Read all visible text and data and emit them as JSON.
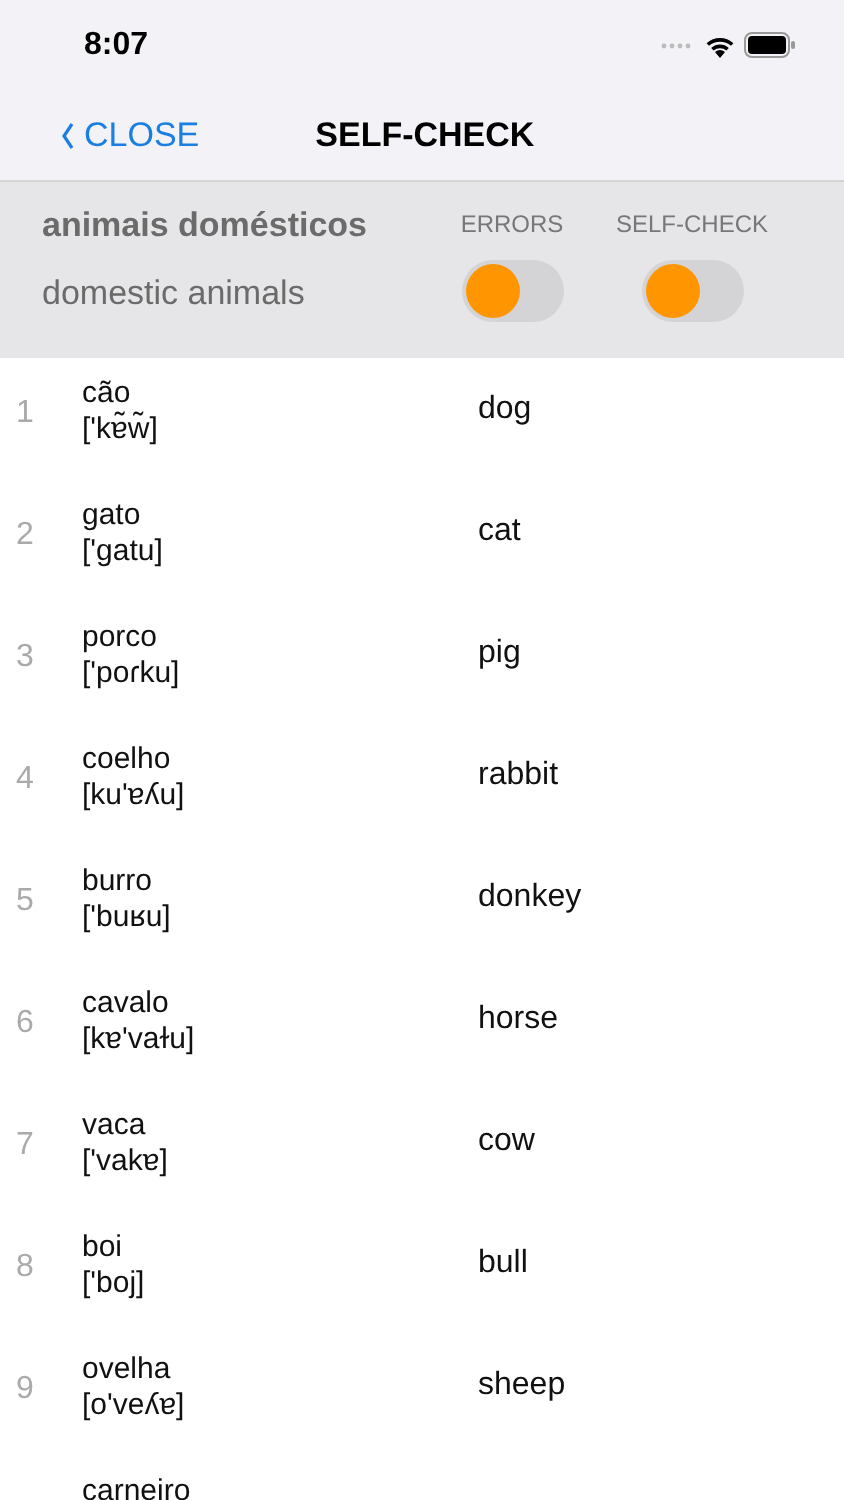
{
  "status_bar": {
    "time": "8:07"
  },
  "nav": {
    "back": "CLOSE",
    "title": "SELF-CHECK"
  },
  "header": {
    "title": "animais domésticos",
    "subtitle": "domestic animals",
    "switches": [
      {
        "label": "ERRORS",
        "on": false
      },
      {
        "label": "SELF-CHECK",
        "on": false
      }
    ]
  },
  "rows": [
    {
      "number": "1",
      "word": "cão",
      "ipa": "['kɐ̃w̃]",
      "translation": "dog"
    },
    {
      "number": "2",
      "word": "gato",
      "ipa": "['gatu]",
      "translation": "cat"
    },
    {
      "number": "3",
      "word": "porco",
      "ipa": "['poɾku]",
      "translation": "pig"
    },
    {
      "number": "4",
      "word": "coelho",
      "ipa": "[ku'ɐʎu]",
      "translation": "rabbit"
    },
    {
      "number": "5",
      "word": "burro",
      "ipa": "['buʁu]",
      "translation": "donkey"
    },
    {
      "number": "6",
      "word": "cavalo",
      "ipa": "[kɐ'vaɫu]",
      "translation": "horse"
    },
    {
      "number": "7",
      "word": "vaca",
      "ipa": "['vakɐ]",
      "translation": "cow"
    },
    {
      "number": "8",
      "word": "boi",
      "ipa": "['boj]",
      "translation": "bull"
    },
    {
      "number": "9",
      "word": "ovelha",
      "ipa": "[o'veʎɐ]",
      "translation": "sheep"
    },
    {
      "word": "carneiro"
    }
  ]
}
